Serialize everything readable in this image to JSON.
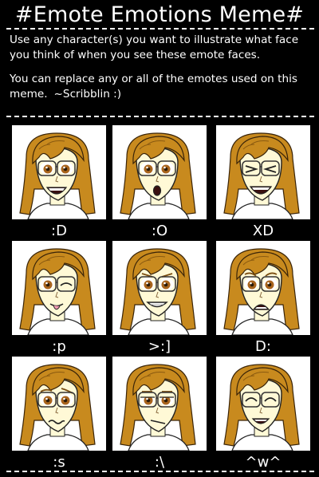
{
  "title": "#Emote Emotions Meme#",
  "instructions": {
    "line1": "Use any character(s) you want to illustrate what face you think of when you see these emote faces.",
    "line2": "You can replace any or all of the emotes used on this meme.",
    "signature": "~Scribblin :)"
  },
  "colors": {
    "background": "#000000",
    "text": "#ffffff",
    "hair": "#c88a1e",
    "skin": "#fff9d6",
    "eyes": "#a8641c"
  },
  "emotes": [
    {
      "label": ":D",
      "face": "big-grin"
    },
    {
      "label": ":O",
      "face": "surprised"
    },
    {
      "label": "XD",
      "face": "laughing-squint"
    },
    {
      "label": ":p",
      "face": "tongue-wink"
    },
    {
      "label": ">:]",
      "face": "smirk-grin"
    },
    {
      "label": "D:",
      "face": "worried"
    },
    {
      "label": ":s",
      "face": "confused"
    },
    {
      "label": ":\\",
      "face": "unimpressed"
    },
    {
      "label": "^w^",
      "face": "happy-closed"
    }
  ]
}
